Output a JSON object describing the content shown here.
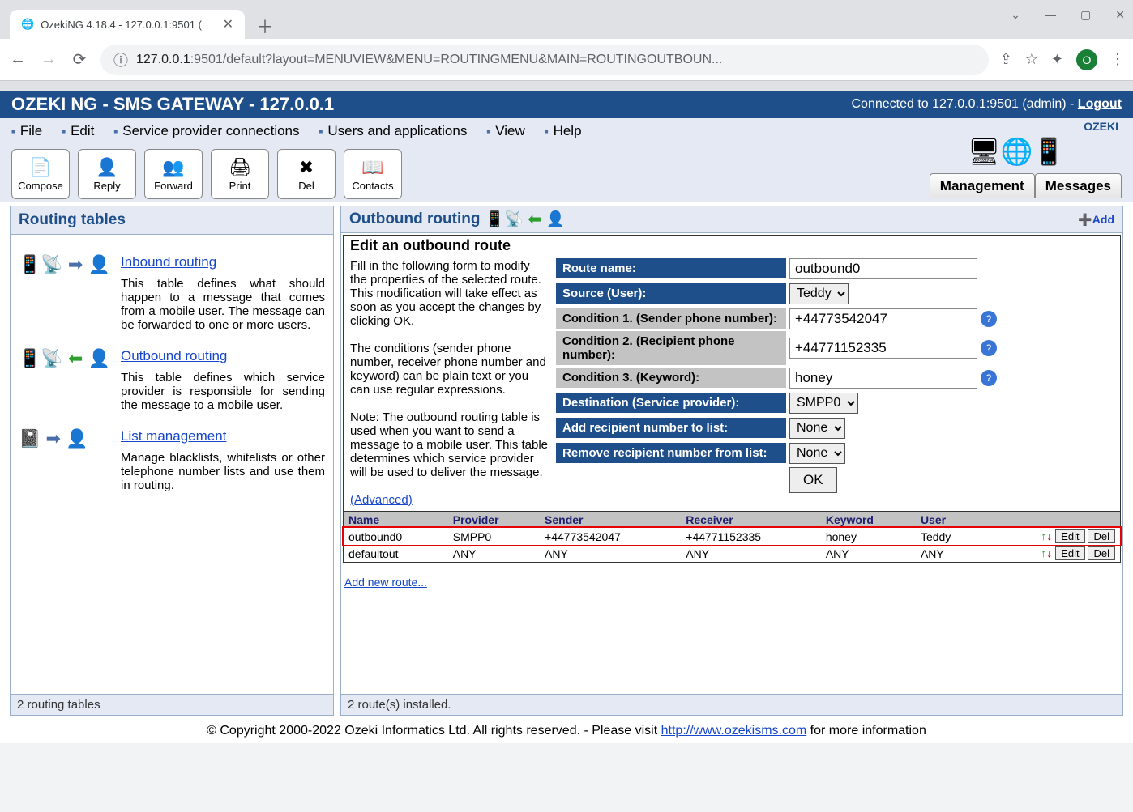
{
  "browser": {
    "tab_title": "OzekiNG 4.18.4 - 127.0.0.1:9501 (",
    "url_host": "127.0.0.1",
    "url_port": ":9501",
    "url_path": "/default?layout=MENUVIEW&MENU=ROUTINGMENU&MAIN=ROUTINGOUTBOUN...",
    "profile_letter": "O"
  },
  "header": {
    "title": "OZEKI NG - SMS GATEWAY - 127.0.0.1",
    "conn_text": "Connected to 127.0.0.1:9501 (admin) - ",
    "logout": "Logout"
  },
  "menus": {
    "file": "File",
    "edit": "Edit",
    "spc": "Service provider connections",
    "ua": "Users and applications",
    "view": "View",
    "help": "Help"
  },
  "toolbar": {
    "compose": "Compose",
    "reply": "Reply",
    "forward": "Forward",
    "print": "Print",
    "del": "Del",
    "contacts": "Contacts"
  },
  "tabs": {
    "management": "Management",
    "messages": "Messages"
  },
  "brand": "OZEKI",
  "left": {
    "title": "Routing tables",
    "footer": "2 routing tables",
    "inbound": {
      "title": "Inbound routing",
      "desc": "This table defines what should happen to a message that comes from a mobile user. The message can be forwarded to one or more users."
    },
    "outbound": {
      "title": "Outbound routing",
      "desc": "This table defines which service provider is responsible for sending the message to a mobile user."
    },
    "list": {
      "title": "List management",
      "desc": "Manage blacklists, whitelists or other telephone number lists and use them in routing."
    }
  },
  "right": {
    "title": "Outbound routing",
    "add": "Add",
    "footer": "2 route(s) installed.",
    "form": {
      "heading": "Edit an outbound route",
      "desc1": "Fill in the following form to modify the properties of the selected route. This modification will take effect as soon as you accept the changes by clicking OK.",
      "desc2": "The conditions (sender phone number, receiver phone number and keyword) can be plain text or you can use regular expressions.",
      "desc3": "Note: The outbound routing table is used when you want to send a message to a mobile user. This table determines which service provider will be used to deliver the message.",
      "advanced": "(Advanced)",
      "labels": {
        "route_name": "Route name:",
        "source": "Source (User):",
        "cond1": "Condition 1. (Sender phone number):",
        "cond2": "Condition 2. (Recipient phone number):",
        "cond3": "Condition 3. (Keyword):",
        "dest": "Destination (Service provider):",
        "add_list": "Add recipient number to list:",
        "rem_list": "Remove recipient number from list:"
      },
      "values": {
        "route_name": "outbound0",
        "source": "Teddy",
        "cond1": "+44773542047",
        "cond2": "+44771152335",
        "cond3": "honey",
        "dest": "SMPP0",
        "add_list": "None",
        "rem_list": "None",
        "ok": "OK"
      }
    },
    "table": {
      "headers": {
        "name": "Name",
        "provider": "Provider",
        "sender": "Sender",
        "receiver": "Receiver",
        "keyword": "Keyword",
        "user": "User"
      },
      "rows": [
        {
          "name": "outbound0",
          "provider": "SMPP0",
          "sender": "+44773542047",
          "receiver": "+44771152335",
          "keyword": "honey",
          "user": "Teddy",
          "hl": true
        },
        {
          "name": "defaultout",
          "provider": "ANY",
          "sender": "ANY",
          "receiver": "ANY",
          "keyword": "ANY",
          "user": "ANY",
          "hl": false
        }
      ],
      "edit": "Edit",
      "del": "Del",
      "add_new": "Add new route..."
    }
  },
  "footer": {
    "pre": "© Copyright 2000-2022 Ozeki Informatics Ltd. All rights reserved. - Please visit ",
    "link": "http://www.ozekisms.com",
    "post": " for more information"
  }
}
